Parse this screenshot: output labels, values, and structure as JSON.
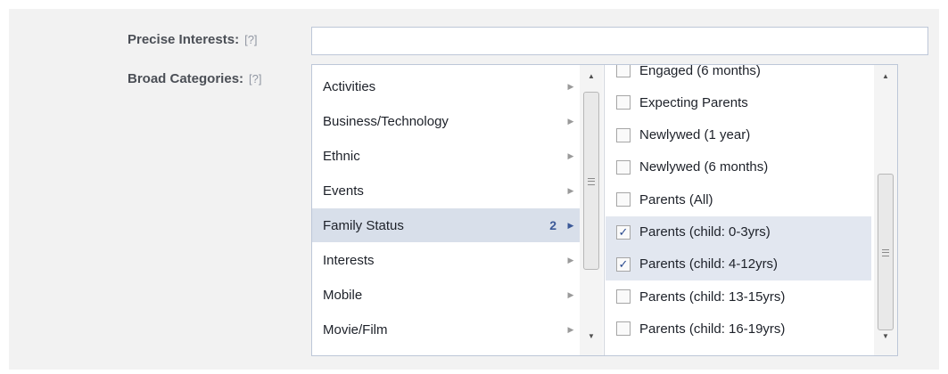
{
  "precise_interests": {
    "label": "Precise Interests:",
    "help": "[?]",
    "value": ""
  },
  "broad_categories": {
    "label": "Broad Categories:",
    "help": "[?]",
    "categories": [
      {
        "label": "Activities",
        "count": "",
        "selected": false
      },
      {
        "label": "Business/Technology",
        "count": "",
        "selected": false
      },
      {
        "label": "Ethnic",
        "count": "",
        "selected": false
      },
      {
        "label": "Events",
        "count": "",
        "selected": false
      },
      {
        "label": "Family Status",
        "count": "2",
        "selected": true
      },
      {
        "label": "Interests",
        "count": "",
        "selected": false
      },
      {
        "label": "Mobile",
        "count": "",
        "selected": false
      },
      {
        "label": "Movie/Film",
        "count": "",
        "selected": false
      }
    ],
    "options": [
      {
        "label": "Engaged (6 months)",
        "checked": false
      },
      {
        "label": "Expecting Parents",
        "checked": false
      },
      {
        "label": "Newlywed (1 year)",
        "checked": false
      },
      {
        "label": "Newlywed (6 months)",
        "checked": false
      },
      {
        "label": "Parents (All)",
        "checked": false
      },
      {
        "label": "Parents (child: 0-3yrs)",
        "checked": true
      },
      {
        "label": "Parents (child: 4-12yrs)",
        "checked": true
      },
      {
        "label": "Parents (child: 13-15yrs)",
        "checked": false
      },
      {
        "label": "Parents (child: 16-19yrs)",
        "checked": false
      }
    ]
  },
  "icons": {
    "chevron_right": "▶",
    "scroll_up": "▲",
    "scroll_down": "▼",
    "check": "✓"
  },
  "colors": {
    "label_text": "#4b4f56",
    "selected_row": "#d8dfea",
    "checked_row": "#e2e7f0",
    "count_accent": "#3b5998"
  }
}
